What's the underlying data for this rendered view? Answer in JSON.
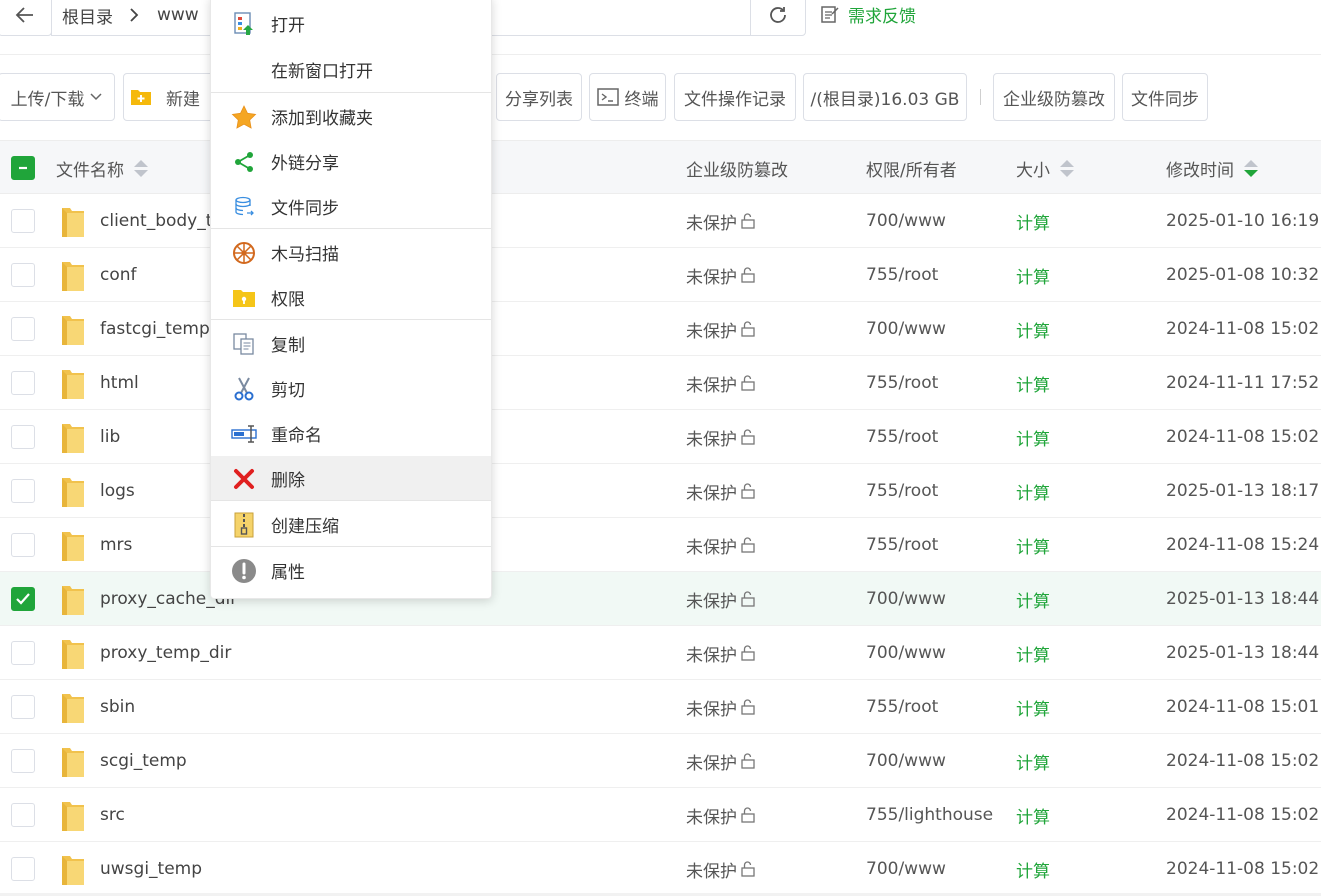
{
  "pathbar": {
    "crumbs": [
      "根目录",
      "www"
    ],
    "feedback_label": "需求反馈"
  },
  "toolbar": {
    "upload_download": "上传/下载",
    "new_label": "新建",
    "share_list": "分享列表",
    "terminal": "终端",
    "file_log": "文件操作记录",
    "disk": "/(根目录)16.03 GB",
    "tamper": "企业级防篡改",
    "file_sync": "文件同步"
  },
  "table": {
    "headers": {
      "name": "文件名称",
      "tamper": "企业级防篡改",
      "perm": "权限/所有者",
      "size": "大小",
      "mtime": "修改时间"
    },
    "rows": [
      {
        "name": "client_body_t",
        "prot": "未保护",
        "perm": "700/www",
        "size": "计算",
        "time": "2025-01-10 16:19:",
        "checked": false
      },
      {
        "name": "conf",
        "prot": "未保护",
        "perm": "755/root",
        "size": "计算",
        "time": "2025-01-08 10:32:",
        "checked": false
      },
      {
        "name": "fastcgi_temp",
        "prot": "未保护",
        "perm": "700/www",
        "size": "计算",
        "time": "2024-11-08 15:02:",
        "checked": false
      },
      {
        "name": "html",
        "prot": "未保护",
        "perm": "755/root",
        "size": "计算",
        "time": "2024-11-11 17:52:",
        "checked": false
      },
      {
        "name": "lib",
        "prot": "未保护",
        "perm": "755/root",
        "size": "计算",
        "time": "2024-11-08 15:02:",
        "checked": false
      },
      {
        "name": "logs",
        "prot": "未保护",
        "perm": "755/root",
        "size": "计算",
        "time": "2025-01-13 18:17:",
        "checked": false
      },
      {
        "name": "mrs",
        "prot": "未保护",
        "perm": "755/root",
        "size": "计算",
        "time": "2024-11-08 15:24:",
        "checked": false
      },
      {
        "name": "proxy_cache_dir",
        "prot": "未保护",
        "perm": "700/www",
        "size": "计算",
        "time": "2025-01-13 18:44:",
        "checked": true
      },
      {
        "name": "proxy_temp_dir",
        "prot": "未保护",
        "perm": "700/www",
        "size": "计算",
        "time": "2025-01-13 18:44:",
        "checked": false
      },
      {
        "name": "sbin",
        "prot": "未保护",
        "perm": "755/root",
        "size": "计算",
        "time": "2024-11-08 15:01:",
        "checked": false
      },
      {
        "name": "scgi_temp",
        "prot": "未保护",
        "perm": "700/www",
        "size": "计算",
        "time": "2024-11-08 15:02:",
        "checked": false
      },
      {
        "name": "src",
        "prot": "未保护",
        "perm": "755/lighthouse",
        "size": "计算",
        "time": "2024-11-08 15:02:",
        "checked": false
      },
      {
        "name": "uwsgi_temp",
        "prot": "未保护",
        "perm": "700/www",
        "size": "计算",
        "time": "2024-11-08 15:02:",
        "checked": false
      }
    ]
  },
  "context_menu": {
    "open": "打开",
    "open_new_window": "在新窗口打开",
    "add_favorite": "添加到收藏夹",
    "external_share": "外链分享",
    "file_sync": "文件同步",
    "trojan_scan": "木马扫描",
    "permission": "权限",
    "copy": "复制",
    "cut": "剪切",
    "rename": "重命名",
    "delete": "删除",
    "compress": "创建压缩",
    "properties": "属性"
  },
  "colors": {
    "accent": "#20a53a",
    "delete_red": "#e02020",
    "folder": "#f8d775"
  }
}
